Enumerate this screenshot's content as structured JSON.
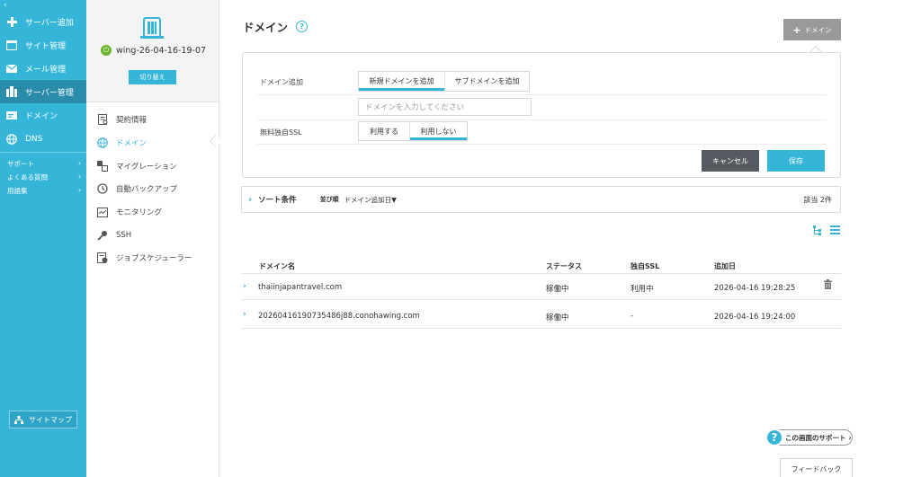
{
  "sidebar": {
    "collapse_label": "‹",
    "items": [
      {
        "label": "サーバー追加",
        "icon": "plus-icon"
      },
      {
        "label": "サイト管理",
        "icon": "window-icon"
      },
      {
        "label": "メール管理",
        "icon": "envelope-icon"
      },
      {
        "label": "サーバー管理",
        "icon": "server-icon"
      },
      {
        "label": "ドメイン",
        "icon": "id-card-icon"
      },
      {
        "label": "DNS",
        "icon": "globe-icon"
      }
    ],
    "links": [
      {
        "label": "サポート"
      },
      {
        "label": "よくある質問"
      },
      {
        "label": "用語集"
      }
    ],
    "sitemap_label": "サイトマップ"
  },
  "server": {
    "name": "wing-26-04-16-19-07",
    "switch_label": "切り替え"
  },
  "subnav": {
    "items": [
      {
        "label": "契約情報",
        "icon": "contract-icon"
      },
      {
        "label": "ドメイン",
        "icon": "globe-icon"
      },
      {
        "label": "マイグレーション",
        "icon": "migration-icon"
      },
      {
        "label": "自動バックアップ",
        "icon": "backup-icon"
      },
      {
        "label": "モニタリング",
        "icon": "monitor-icon"
      },
      {
        "label": "SSH",
        "icon": "key-icon"
      },
      {
        "label": "ジョブスケジューラー",
        "icon": "scheduler-icon"
      }
    ]
  },
  "main": {
    "title": "ドメイン",
    "help": "?",
    "add_button": "ドメイン",
    "form": {
      "domain_add_label": "ドメイン追加",
      "tab_new": "新規ドメインを追加",
      "tab_sub": "サブドメインを追加",
      "domain_placeholder": "ドメインを入力してください",
      "ssl_label": "無料独自SSL",
      "ssl_use": "利用する",
      "ssl_nouse": "利用しない",
      "cancel": "キャンセル",
      "save": "保存"
    },
    "sort": {
      "title": "ソート条件",
      "order_label": "並び順",
      "order_value": "ドメイン追加日▼",
      "count": "該当 2件"
    },
    "table": {
      "headers": {
        "name": "ドメイン名",
        "status": "ステータス",
        "ssl": "独自SSL",
        "date": "追加日"
      },
      "rows": [
        {
          "name": "thaiinjapantravel.com",
          "status": "稼働中",
          "ssl": "利用中",
          "date": "2026-04-16 19:28:25"
        },
        {
          "name": "20260416190735486j88.conohawing.com",
          "status": "稼働中",
          "ssl": "-",
          "date": "2026-04-16 19:24:00"
        }
      ]
    }
  },
  "support_label": "この画面のサポート",
  "feedback_label": "フィードバック",
  "colors": {
    "accent": "#35b6d8",
    "sidebar_active": "#2a8cab",
    "cancel": "#555b60",
    "add_button": "#9a9a9a",
    "power": "#6ab42d"
  }
}
